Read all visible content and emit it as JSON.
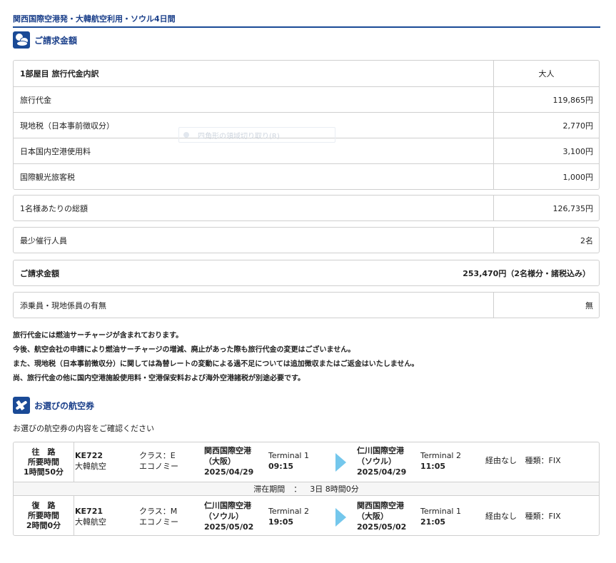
{
  "tour_title": "関西国際空港発・大韓航空利用・ソウル4日間",
  "billing": {
    "heading": "ご請求金額",
    "header": {
      "label": "1部屋目 旅行代金内訳",
      "col": "大人"
    },
    "rows": [
      {
        "label": "旅行代金",
        "value": "119,865円"
      },
      {
        "label": "現地税（日本事前徴収分）",
        "value": "2,770円"
      },
      {
        "label": "日本国内空港使用料",
        "value": "3,100円"
      },
      {
        "label": "国際観光旅客税",
        "value": "1,000円"
      }
    ],
    "per_person": {
      "label": "1名様あたりの総額",
      "value": "126,735円"
    },
    "min_people": {
      "label": "最少催行人員",
      "value": "2名"
    },
    "total": {
      "label": "ご請求金額",
      "value": "253,470円（2名様分・諸税込み）"
    },
    "escort": {
      "label": "添乗員・現地係員の有無",
      "value": "無"
    }
  },
  "ghost_tooltip": "四角形の領域切り取り(R)",
  "notes": [
    "旅行代金には燃油サーチャージが含まれております。",
    "今後、航空会社の申請により燃油サーチャージの増減、廃止があった際も旅行代金の変更はございません。",
    "また、現地税（日本事前徴収分）に関しては為替レートの変動による過不足については追加徴収またはご返金はいたしません。",
    "尚、旅行代金の他に国内空港施設使用料・空港保安料および海外空港諸税が別途必要です。"
  ],
  "flights_section": {
    "heading": "お選びの航空券",
    "subtitle": "お選びの航空券の内容をご確認ください",
    "outbound": {
      "dir": "往　路",
      "time_label": "所要時間",
      "duration": "1時間50分",
      "flight_no": "KE722",
      "airline": "大韓航空",
      "class_code": "クラス：E",
      "class_name": "エコノミー",
      "dep_airport": "関西国際空港",
      "dep_city": "（大阪）",
      "dep_date": "2025/04/29",
      "dep_terminal": "Terminal 1",
      "dep_time": "09:15",
      "arr_airport": "仁川国際空港",
      "arr_city": "（ソウル）",
      "arr_date": "2025/04/29",
      "arr_terminal": "Terminal 2",
      "arr_time": "11:05",
      "via": "経由なし",
      "type": "種類：FIX"
    },
    "stay": {
      "label": "滞在期間",
      "sep": "：",
      "value": "3日 8時間0分"
    },
    "return": {
      "dir": "復　路",
      "time_label": "所要時間",
      "duration": "2時間0分",
      "flight_no": "KE721",
      "airline": "大韓航空",
      "class_code": "クラス：M",
      "class_name": "エコノミー",
      "dep_airport": "仁川国際空港",
      "dep_city": "（ソウル）",
      "dep_date": "2025/05/02",
      "dep_terminal": "Terminal 2",
      "dep_time": "19:05",
      "arr_airport": "関西国際空港",
      "arr_city": "（大阪）",
      "arr_date": "2025/05/02",
      "arr_terminal": "Terminal 1",
      "arr_time": "21:05",
      "via": "経由なし",
      "type": "種類：FIX"
    }
  },
  "colors": {
    "accent": "#1a4a96",
    "arrow": "#74c7ec",
    "border": "#cfcfcf"
  },
  "icons": {
    "billing": "coins-icon",
    "flights": "airplane-icon"
  }
}
